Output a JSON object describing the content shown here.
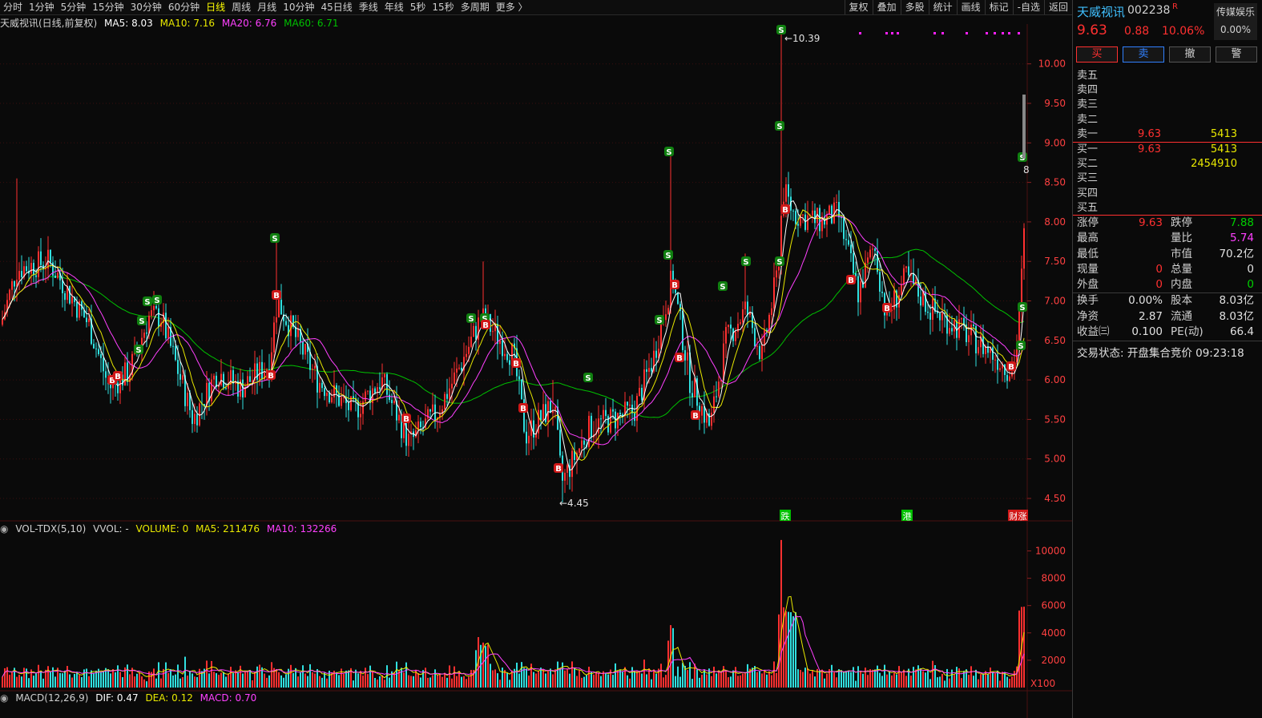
{
  "toolbar": {
    "periods": [
      "分时",
      "1分钟",
      "5分钟",
      "15分钟",
      "30分钟",
      "60分钟",
      "日线",
      "周线",
      "月线",
      "10分钟",
      "45日线",
      "季线",
      "年线",
      "5秒",
      "15秒",
      "多周期",
      "更多 〉"
    ],
    "active_period": "日线",
    "right_items": [
      "复权",
      "叠加",
      "多股",
      "统计",
      "画线",
      "标记",
      "-自选",
      "返回"
    ]
  },
  "main_legend": {
    "title": "天威视讯(日线,前复权)",
    "ma5": "MA5: 8.03",
    "ma10": "MA10: 7.16",
    "ma20": "MA20: 6.76",
    "ma60": "MA60: 6.71"
  },
  "vol_legend": {
    "title": "VOL-TDX(5,10)",
    "vvol": "VVOL: -",
    "volume": "VOLUME: 0",
    "ma5": "MA5: 211476",
    "ma10": "MA10: 132266"
  },
  "macd_legend": {
    "title": "MACD(12,26,9)",
    "dif": "DIF: 0.47",
    "dea": "DEA: 0.12",
    "macd": "MACD: 0.70"
  },
  "price_axis": [
    "10.00",
    "9.50",
    "9.00",
    "8.50",
    "8.00",
    "7.50",
    "7.00",
    "6.50",
    "6.00",
    "5.50",
    "5.00",
    "4.50"
  ],
  "vol_axis": [
    "10000",
    "8000",
    "6000",
    "4000",
    "2000"
  ],
  "vol_unit": "X100",
  "annotations": {
    "high": "10.39",
    "low": "4.45",
    "last_hint": "8"
  },
  "event_labels": [
    "跌",
    "港",
    "财",
    "涨"
  ],
  "colors": {
    "up": "#ff3030",
    "down": "#30e0e0",
    "ma5": "#ffffff",
    "ma10": "#e8e800",
    "ma20": "#ff40ff",
    "ma60": "#00c000"
  },
  "stock": {
    "name": "天威视讯",
    "code": "002238",
    "flag": "R",
    "price": "9.63",
    "change": "0.88",
    "pct": "10.06%",
    "sector": "传媒娱乐",
    "sector_pct": "0.00%"
  },
  "buttons": [
    "买",
    "卖",
    "撤",
    "警"
  ],
  "order_book": {
    "asks": [
      {
        "label": "卖五",
        "price": "",
        "vol": ""
      },
      {
        "label": "卖四",
        "price": "",
        "vol": ""
      },
      {
        "label": "卖三",
        "price": "",
        "vol": ""
      },
      {
        "label": "卖二",
        "price": "",
        "vol": ""
      },
      {
        "label": "卖一",
        "price": "9.63",
        "vol": "5413"
      }
    ],
    "bids": [
      {
        "label": "买一",
        "price": "9.63",
        "vol": "5413"
      },
      {
        "label": "买二",
        "price": "",
        "vol": "2454910"
      },
      {
        "label": "买三",
        "price": "",
        "vol": ""
      },
      {
        "label": "买四",
        "price": "",
        "vol": ""
      },
      {
        "label": "买五",
        "price": "",
        "vol": ""
      }
    ]
  },
  "stats": [
    {
      "l1": "涨停",
      "v1": "9.63",
      "c1": "red",
      "l2": "跌停",
      "v2": "7.88",
      "c2": "green"
    },
    {
      "l1": "最高",
      "v1": "",
      "c1": "white",
      "l2": "量比",
      "v2": "5.74",
      "c2": "mag"
    },
    {
      "l1": "最低",
      "v1": "",
      "c1": "white",
      "l2": "市值",
      "v2": "70.2亿",
      "c2": "white"
    },
    {
      "l1": "现量",
      "v1": "0",
      "c1": "red",
      "l2": "总量",
      "v2": "0",
      "c2": "white"
    },
    {
      "l1": "外盘",
      "v1": "0",
      "c1": "red",
      "l2": "内盘",
      "v2": "0",
      "c2": "green"
    },
    {
      "l1": "换手",
      "v1": "0.00%",
      "c1": "white",
      "l2": "股本",
      "v2": "8.03亿",
      "c2": "white"
    },
    {
      "l1": "净资",
      "v1": "2.87",
      "c1": "white",
      "l2": "流通",
      "v2": "8.03亿",
      "c2": "white"
    },
    {
      "l1": "收益㈢",
      "v1": "0.100",
      "c1": "white",
      "l2": "PE(动)",
      "v2": "66.4",
      "c2": "white"
    }
  ],
  "status_text": "交易状态: 开盘集合竞价 09:23:18"
}
